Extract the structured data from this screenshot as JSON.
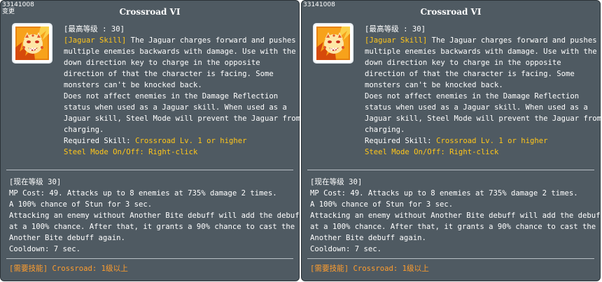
{
  "panels": [
    {
      "skill_id": "33141008",
      "tag": "变更",
      "title": "Crossroad VI",
      "icon": "jaguar-crossroad-skill-icon",
      "max_level": "[最高等级 : 30]",
      "skill_label": "[Jaguar Skill]",
      "desc_first": " The Jaguar charges forward and pushes",
      "desc_lines": [
        "multiple enemies backwards with damage. Use with the",
        "down direction key to charge in the opposite",
        "direction of that the character is facing. Some",
        "monsters can't be knocked back.",
        "Does not affect enemies in the Damage Reflection",
        "status when used as a Jaguar skill. When used as a",
        "Jaguar skill, Steel Mode will prevent the Jaguar from",
        "charging."
      ],
      "required_prefix": "Required Skill: ",
      "required_value": "Crossroad Lv. 1 or higher",
      "steel_mode": "Steel Mode On/Off: Right-click",
      "current_level": "[现在等级 30]",
      "current_lines": [
        "MP Cost: 49. Attacks up to 8 enemies at 735% damage 2 times.",
        "A 100% chance of Stun for 3 sec.",
        "Attacking an enemy without Another Bite debuff will add the debuff",
        "at a 100% chance. After that, it grants a 90% chance to cast the",
        "Another Bite debuff again.",
        "Cooldown: 7 sec."
      ],
      "required_footer": "[需要技能] Crossroad: 1级以上"
    },
    {
      "skill_id": "33141008",
      "tag": "",
      "title": "Crossroad VI",
      "icon": "jaguar-crossroad-skill-icon",
      "max_level": "[最高等级 : 30]",
      "skill_label": "[Jaguar Skill]",
      "desc_first": " The Jaguar charges forward and pushes",
      "desc_lines": [
        "multiple enemies backwards with damage. Use with the",
        "down direction key to charge in the opposite",
        "direction of that the character is facing. Some",
        "monsters can't be knocked back.",
        "Does not affect enemies in the Damage Reflection",
        "status when used as a Jaguar skill. When used as a",
        "Jaguar skill, Steel Mode will prevent the Jaguar from",
        "charging."
      ],
      "required_prefix": "Required Skill: ",
      "required_value": "Crossroad Lv. 1 or higher",
      "steel_mode": "Steel Mode On/Off: Right-click",
      "current_level": "[现在等级 30]",
      "current_lines": [
        "MP Cost: 49. Attacks up to 8 enemies at 735% damage 2 times.",
        "A 100% chance of Stun for 3 sec.",
        "Attacking an enemy without Another Bite debuff will add the debuff",
        "at a 100% chance. After that, it grants a 90% chance to cast the",
        "Another Bite debuff again.",
        "Cooldown: 7 sec."
      ],
      "required_footer": "[需要技能] Crossroad: 1级以上"
    }
  ],
  "colors": {
    "panel_bg": "#4f5a62",
    "highlight_gold": "#ffc61a",
    "highlight_orange": "#ff9d2d",
    "text": "#ffffff"
  }
}
